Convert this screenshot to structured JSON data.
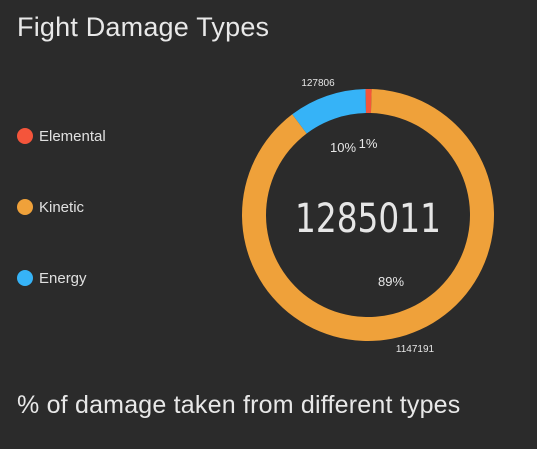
{
  "widget": {
    "title": "Fight Damage Types",
    "subtitle": "% of damage taken from different types"
  },
  "chart_data": {
    "type": "pie",
    "style": "donut",
    "total": "1285011",
    "legend_position": "left",
    "slices": [
      {
        "name": "Elemental",
        "value": 10014,
        "percent_label": "1%",
        "color": "#f4553b"
      },
      {
        "name": "Kinetic",
        "value": 1147191,
        "percent_label": "89%",
        "value_label": "1147191",
        "color": "#efa13a"
      },
      {
        "name": "Energy",
        "value": 127806,
        "percent_label": "10%",
        "value_label": "127806",
        "color": "#36b3f7"
      }
    ]
  }
}
